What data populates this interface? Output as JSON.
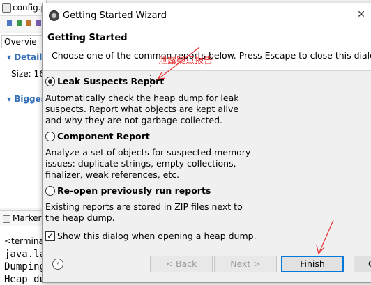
{
  "background": {
    "editor_tab": "config.p",
    "subtab": "Overvie",
    "section_details": "Details",
    "size_label": "Size: 16",
    "section_biggest": "Bigges",
    "markers_tab": "Marker",
    "console_lines": [
      "<terminat",
      "java.la",
      "Dumping",
      "Heap du"
    ]
  },
  "dialog": {
    "title": "Getting Started Wizard",
    "close_symbol": "✕",
    "header_title": "Getting Started",
    "header_desc": "Choose one of the common reports below. Press Escape to close this dialog.",
    "options": [
      {
        "label": "Leak Suspects Report",
        "selected": true,
        "description": "Automatically check the heap dump for leak suspects. Report what objects are kept alive and why they are not garbage collected."
      },
      {
        "label": "Component Report",
        "selected": false,
        "description": "Analyze a set of objects for suspected memory issues: duplicate strings, empty collections, finalizer, weak references, etc."
      },
      {
        "label": "Re-open previously run reports",
        "selected": false,
        "description": "Existing reports are stored in ZIP files next to the heap dump."
      }
    ],
    "checkbox_label": "Show this dialog when opening a heap dump.",
    "checkbox_checked": true,
    "buttons": {
      "help": "?",
      "back": "< Back",
      "next": "Next >",
      "finish": "Finish",
      "cancel": "C"
    }
  },
  "annotation": {
    "text": "泄露疑点报告",
    "color": "#e83030"
  }
}
